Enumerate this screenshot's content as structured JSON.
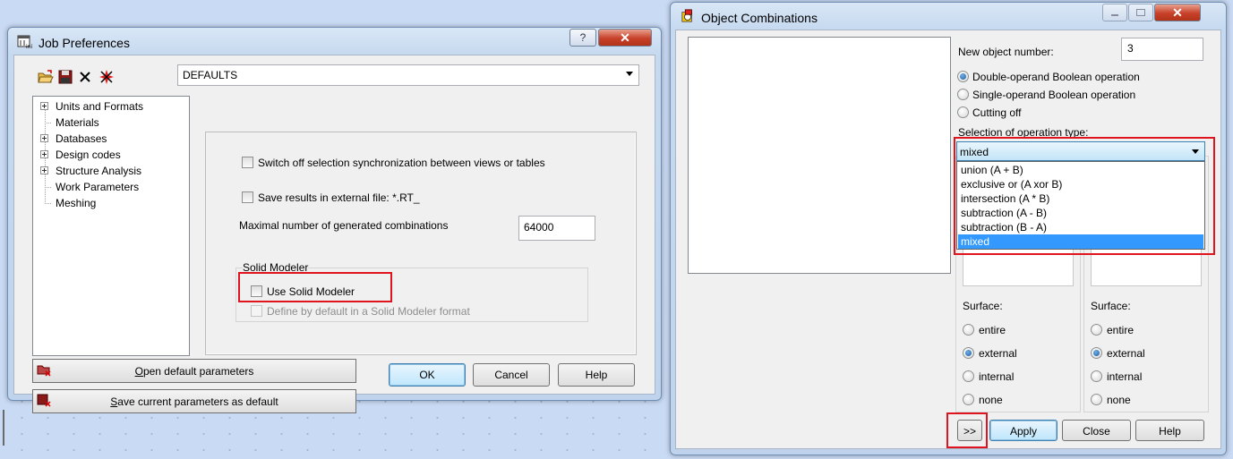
{
  "job": {
    "title": "Job Preferences",
    "help_btn": "?",
    "close_btn": "✕",
    "preset": "DEFAULTS",
    "tree": [
      {
        "label": "Units and Formats",
        "expandable": true
      },
      {
        "label": "Materials",
        "expandable": false
      },
      {
        "label": "Databases",
        "expandable": true
      },
      {
        "label": "Design codes",
        "expandable": true
      },
      {
        "label": "Structure Analysis",
        "expandable": true
      },
      {
        "label": "Work Parameters",
        "expandable": false
      },
      {
        "label": "Meshing",
        "expandable": false
      }
    ],
    "switch_off_sync": "Switch off selection synchronization between views or tables",
    "save_results": "Save results in external file: *.RT_",
    "max_combinations_label": "Maximal number of generated combinations",
    "max_combinations_value": "64000",
    "solid_group": "Solid Modeler",
    "use_solid": "Use Solid Modeler",
    "define_default": "Define by default in a Solid Modeler format",
    "open_default_first": "O",
    "open_default_rest": "pen default parameters",
    "save_default_first": "S",
    "save_default_rest": "ave current parameters as default",
    "ok": "OK",
    "cancel": "Cancel",
    "help": "Help"
  },
  "combo": {
    "title": "Object Combinations",
    "new_object_label": "New object number:",
    "new_object_value": "3",
    "op_double": "Double-operand Boolean operation",
    "op_single": "Single-operand Boolean operation",
    "op_cut": "Cutting off",
    "selection_label": "Selection of operation type:",
    "selected": "mixed",
    "options": [
      "union (A + B)",
      "exclusive or (A xor B)",
      "intersection (A * B)",
      "subtraction (A - B)",
      "subtraction (B - A)",
      "mixed"
    ],
    "surface_label": "Surface:",
    "surface_options": [
      "entire",
      "external",
      "internal",
      "none"
    ],
    "more_btn": ">>",
    "apply": "Apply",
    "close": "Close",
    "help": "Help"
  },
  "colors": {
    "highlight": "#3399ff",
    "callout": "#e0141e"
  }
}
